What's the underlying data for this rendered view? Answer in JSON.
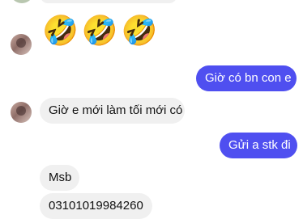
{
  "messages": {
    "emoji_reaction": "🤣🤣🤣",
    "outgoing_1": "Giờ có bn con e",
    "incoming_1": "Giờ e mới làm tối mới có",
    "outgoing_2": "Gửi a stk đi",
    "incoming_2": "Msb",
    "incoming_3": "03101019984260"
  },
  "colors": {
    "outgoing_bubble": "#4f4ff0",
    "incoming_bubble": "#f0f0f0"
  }
}
